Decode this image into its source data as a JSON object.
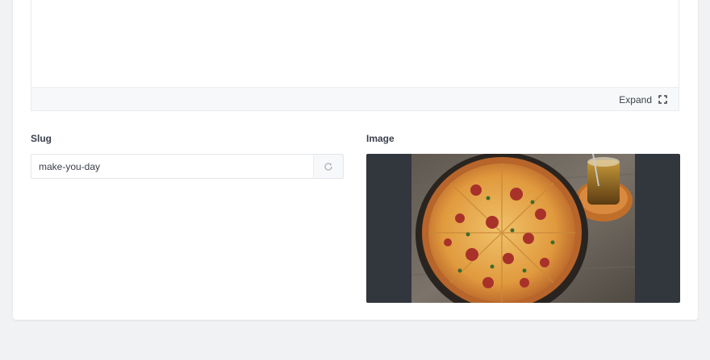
{
  "editor": {
    "expand_label": "Expand",
    "expand_icon": "expand-icon"
  },
  "slug": {
    "label": "Slug",
    "value": "make-you-day",
    "refresh_icon": "refresh-icon"
  },
  "image": {
    "label": "Image",
    "preview_subject": "pizza-photo"
  },
  "colors": {
    "page_background": "#f1f2f4",
    "card_background": "#ffffff",
    "image_letterbox": "#32363d",
    "text": "#3a3f4a"
  }
}
